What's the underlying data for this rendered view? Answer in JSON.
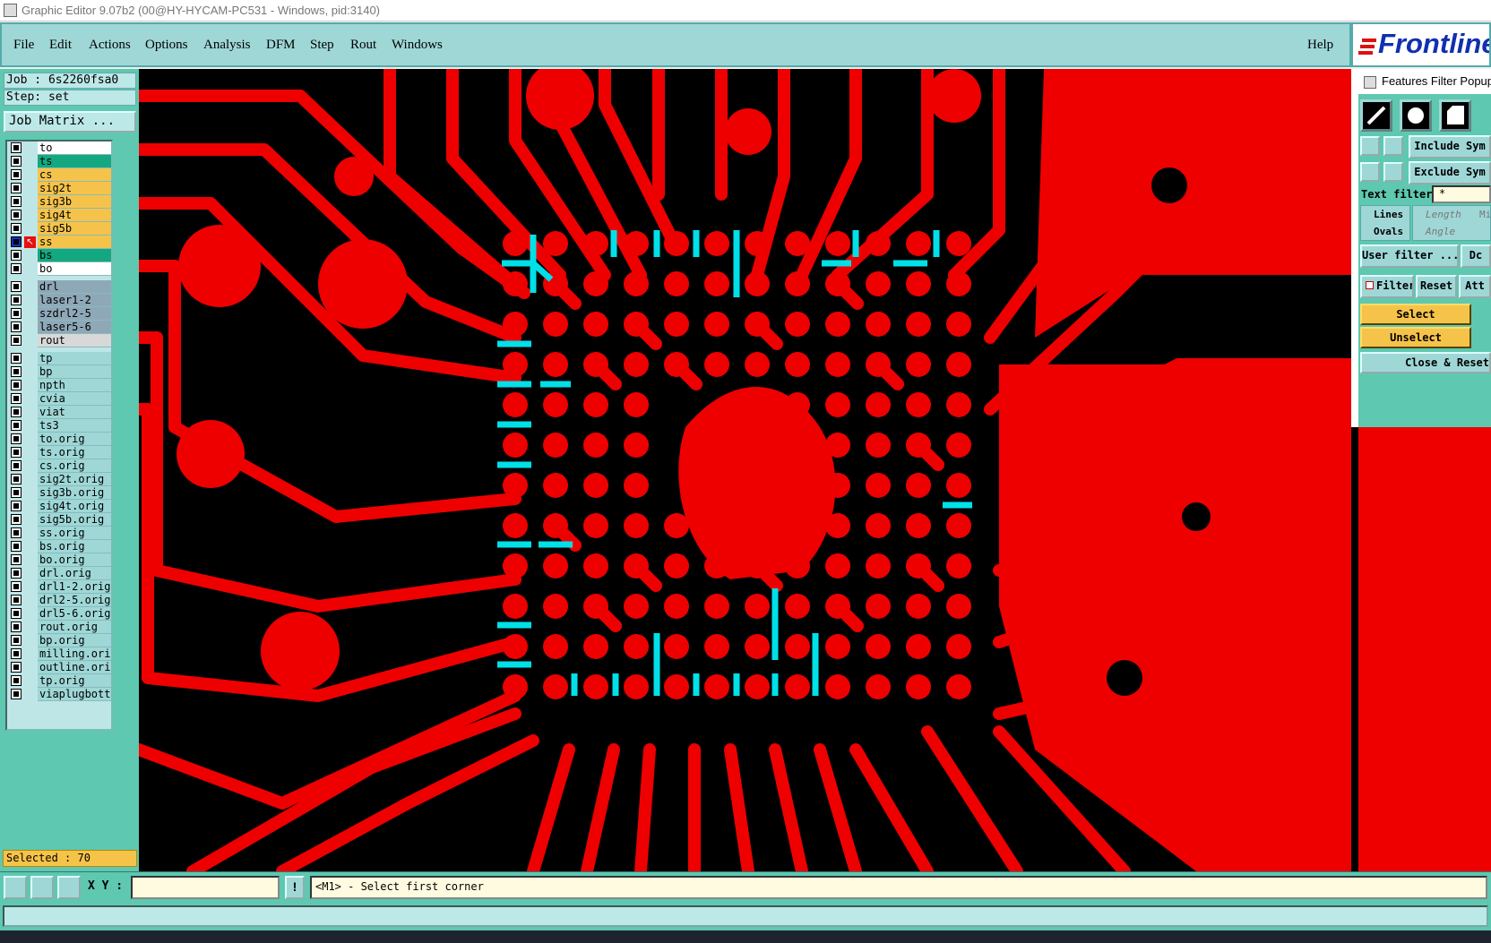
{
  "window": {
    "title": "Graphic Editor 9.07b2 (00@HY-HYCAM-PC531 - Windows, pid:3140)"
  },
  "menu": {
    "items": [
      "File",
      "Edit",
      "Actions",
      "Options",
      "Analysis",
      "DFM",
      "Step",
      "Rout",
      "Windows"
    ],
    "help": "Help"
  },
  "logo": {
    "text": "Frontline"
  },
  "job": {
    "job_label": "Job : 6s2260fsa0",
    "step_label": "Step: set",
    "matrix_button": "Job Matrix ..."
  },
  "layers": {
    "group1": [
      {
        "name": "to",
        "color": "#ffffff"
      },
      {
        "name": "ts",
        "color": "#13a87f"
      },
      {
        "name": "cs",
        "color": "#f6c34a"
      },
      {
        "name": "sig2t",
        "color": "#f6c34a"
      },
      {
        "name": "sig3b",
        "color": "#f6c34a"
      },
      {
        "name": "sig4t",
        "color": "#f6c34a"
      },
      {
        "name": "sig5b",
        "color": "#f6c34a"
      },
      {
        "name": "ss",
        "color": "#f6c34a"
      },
      {
        "name": "bs",
        "color": "#13a87f"
      },
      {
        "name": "bo",
        "color": "#ffffff"
      }
    ],
    "group2": [
      {
        "name": "drl",
        "color": "#8fa8b8"
      },
      {
        "name": "laser1-2",
        "color": "#8fa8b8"
      },
      {
        "name": "szdrl2-5",
        "color": "#8fa8b8"
      },
      {
        "name": "laser5-6",
        "color": "#8fa8b8"
      },
      {
        "name": "rout",
        "color": "#d8d8d8"
      }
    ],
    "group3": [
      "tp",
      "bp",
      "npth",
      "cvia",
      "viat",
      "ts3",
      "to.orig",
      "ts.orig",
      "cs.orig",
      "sig2t.orig",
      "sig3b.orig",
      "sig4t.orig",
      "sig5b.orig",
      "ss.orig",
      "bs.orig",
      "bo.orig",
      "drl.orig",
      "drl1-2.orig",
      "drl2-5.orig",
      "drl5-6.orig",
      "rout.orig",
      "bp.orig",
      "milling.orig",
      "outline.orig",
      "tp.orig",
      "viaplugbottom"
    ],
    "group3_color": "#9fd7d7",
    "active_layer": "ss"
  },
  "status": {
    "selected": "Selected : 70"
  },
  "command": {
    "xy_label": "X Y :",
    "xy_value": "",
    "prompt": "<M1> - Select first corner"
  },
  "features_filter": {
    "title": "Features Filter Popup",
    "include_button": "Include Sym",
    "exclude_button": "Exclude Sym",
    "text_filter_label": "Text filter",
    "text_filter_value": "*",
    "lines_label": "Lines",
    "ovals_label": "Ovals",
    "length_label": "Length",
    "angle_label": "Angle",
    "min_label": "Mi",
    "user_filter_button": "User filter ...",
    "dc_button": "Dc",
    "filter_label": "Filter",
    "reset_button": "Reset",
    "att_button": "Att",
    "select_button": "Select",
    "unselect_button": "Unselect",
    "close_reset_button": "Close & Reset"
  },
  "colors": {
    "board": "#ee0000",
    "background": "#000000",
    "selected": "#00e0e8"
  }
}
